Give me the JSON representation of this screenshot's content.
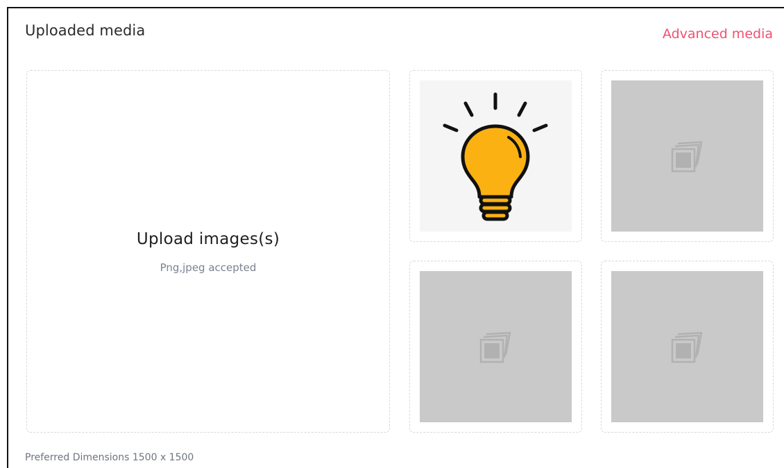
{
  "header": {
    "title": "Uploaded media",
    "advanced_link": "Advanced media"
  },
  "dropzone": {
    "title": "Upload images(s)",
    "subtitle": "Png,jpeg accepted"
  },
  "slots": [
    {
      "state": "filled",
      "icon": "lightbulb-icon"
    },
    {
      "state": "empty",
      "icon": "image-placeholder-icon"
    },
    {
      "state": "empty",
      "icon": "image-placeholder-icon"
    },
    {
      "state": "empty",
      "icon": "image-placeholder-icon"
    }
  ],
  "footer": {
    "note": "Preferred Dimensions 1500 x 1500"
  },
  "colors": {
    "accent": "#f0506e",
    "bulb": "#fbb112",
    "placeholder_bg": "#c9c9c9"
  }
}
